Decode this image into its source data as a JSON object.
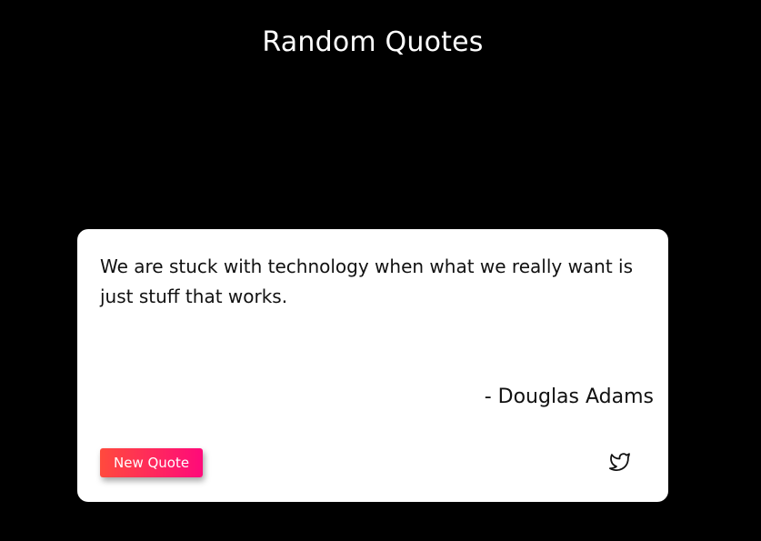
{
  "header": {
    "title": "Random Quotes"
  },
  "quote": {
    "text": "We are stuck with technology when what we really want is just stuff that works.",
    "author": "- Douglas Adams"
  },
  "actions": {
    "new_quote_label": "New Quote",
    "tweet_icon": "twitter-icon"
  },
  "colors": {
    "background": "#000000",
    "card": "#ffffff",
    "button_gradient_start": "#ff4a3d",
    "button_gradient_end": "#ff0a7a"
  }
}
